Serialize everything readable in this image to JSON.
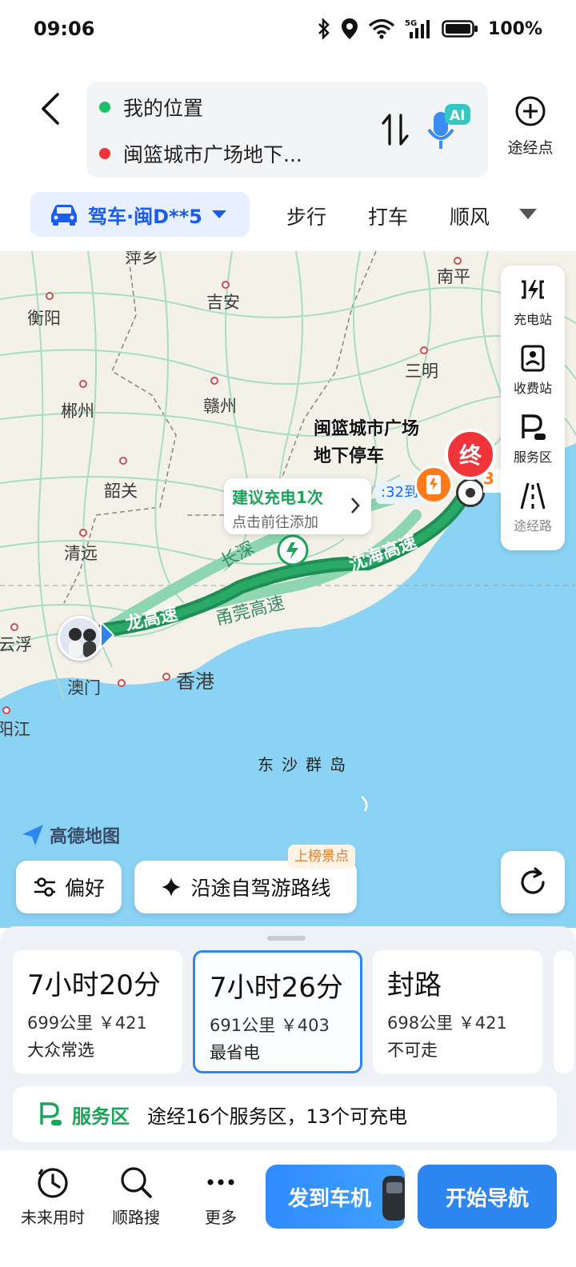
{
  "status_bar": {
    "time": "09:06",
    "battery": "100%",
    "network": "5G",
    "icons": [
      "bluetooth-icon",
      "location-icon",
      "wifi-icon",
      "signal-icon",
      "battery-icon"
    ]
  },
  "header": {
    "origin": "我的位置",
    "destination": "闽篮城市广场地下...",
    "waypoint_label": "途经点",
    "ai_badge": "AI"
  },
  "modes": {
    "drive": "驾车·闽D**5",
    "walk": "步行",
    "taxi": "打车",
    "ride": "顺风"
  },
  "map": {
    "cities": [
      {
        "name": "萍乡"
      },
      {
        "name": "南平"
      },
      {
        "name": "衡阳"
      },
      {
        "name": "吉安"
      },
      {
        "name": "三明"
      },
      {
        "name": "郴州"
      },
      {
        "name": "赣州"
      },
      {
        "name": "韶关"
      },
      {
        "name": "清远"
      },
      {
        "name": "云浮"
      },
      {
        "name": "澳门"
      },
      {
        "name": "香港"
      },
      {
        "name": "阳江"
      }
    ],
    "island_label": "东沙群岛",
    "roads": {
      "main1": "龙高速",
      "main2": "沈海高速",
      "alt1": "甬莞高速",
      "alt2": "长深"
    },
    "destination_label": "闽篮城市广场地下停车",
    "end_pin": "终",
    "eta_chip": ":32到",
    "number_chip": "3",
    "charge_tip": {
      "title": "建议充电1次",
      "subtitle": "点击前往添加"
    },
    "side_tools": {
      "charging": "充电站",
      "toll": "收费站",
      "service": "服务区",
      "via_road": "途经路"
    },
    "logo": "高德地图",
    "prefs_button": "偏好",
    "scenic_button": "沿途自驾游路线",
    "hot_badge": "上榜景点"
  },
  "routes": [
    {
      "time": "7小时20分",
      "dist": "699公里 ￥421",
      "tag": "大众常选"
    },
    {
      "time": "7小时26分",
      "dist": "691公里 ￥403",
      "tag": "最省电"
    },
    {
      "time": "封路",
      "dist": "698公里 ￥421",
      "tag": "不可走"
    }
  ],
  "service_row": {
    "brand": "服务区",
    "desc": "途经16个服务区，13个可充电"
  },
  "bottom_bar": {
    "future": "未来用时",
    "search": "顺路搜",
    "more": "更多",
    "send_to_car": "发到车机",
    "start_nav": "开始导航"
  },
  "colors": {
    "accent": "#2d86f0",
    "route_green": "#1e8e56",
    "end_red": "#f0353a",
    "sea": "#8bd3f4"
  }
}
